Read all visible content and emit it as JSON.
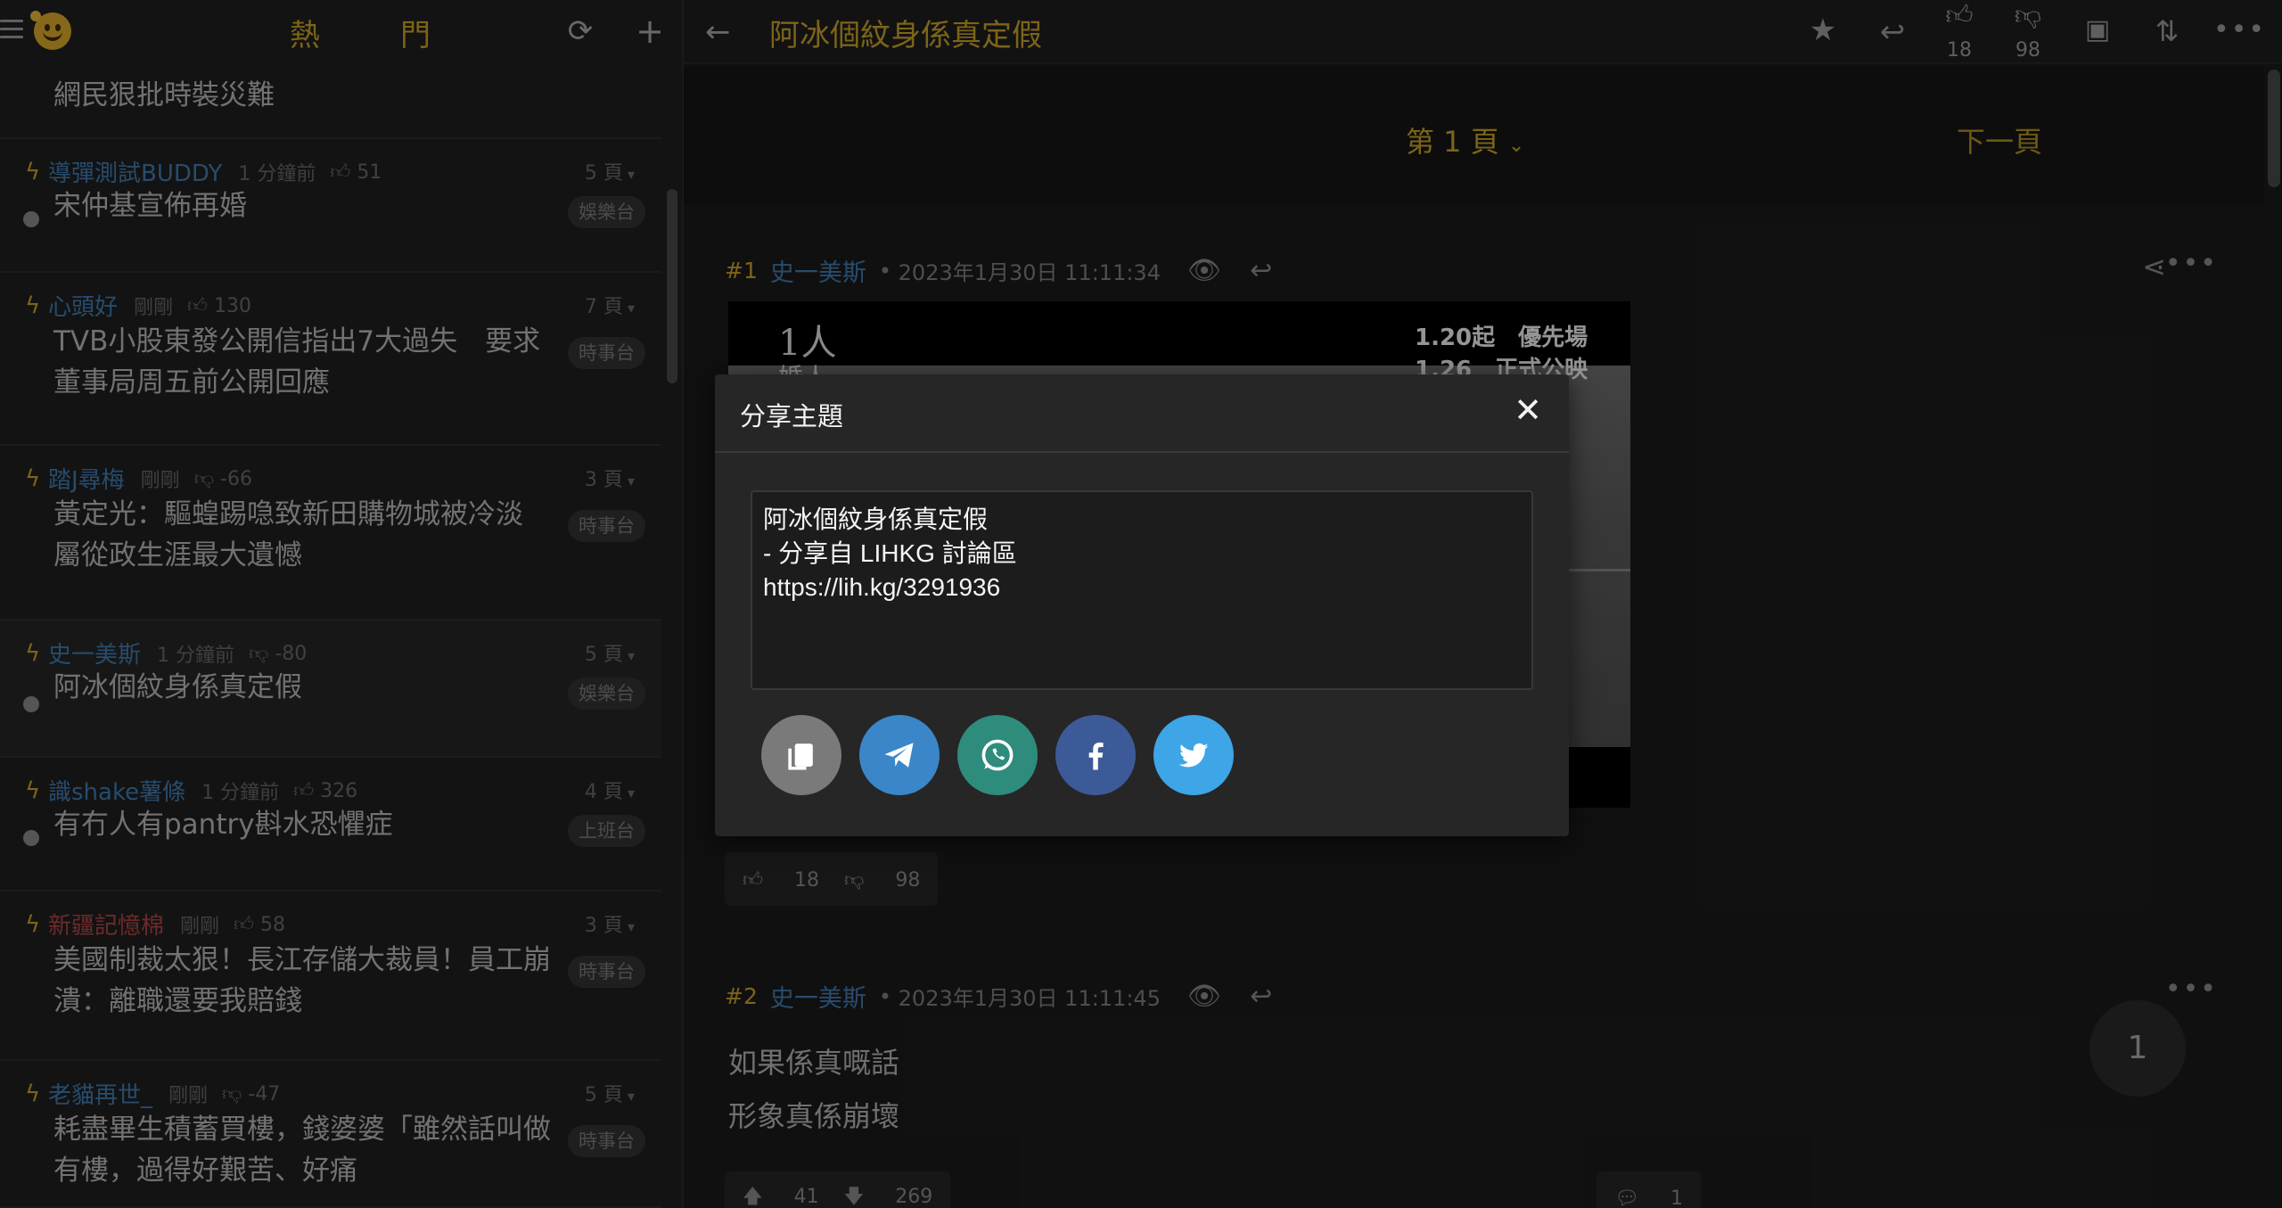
{
  "left_panel": {
    "title": "熱　門",
    "partial_thread_title": "網民狠批時裝災難",
    "threads": [
      {
        "user": "導彈測試BUDDY",
        "time": "1 分鐘前",
        "score": "51",
        "pages": "5 頁",
        "title": "宋仲基宣佈再婚",
        "tag": "娛樂台",
        "score_type": "up",
        "user_color": "blue",
        "active": false
      },
      {
        "user": "心頭好",
        "time": "剛剛",
        "score": "130",
        "pages": "7 頁",
        "title": "TVB小股東發公開信指出7大過失　要求董事局周五前公開回應",
        "tag": "時事台",
        "score_type": "up",
        "user_color": "blue",
        "active": false
      },
      {
        "user": "踏J尋梅",
        "time": "剛剛",
        "score": "-66",
        "pages": "3 頁",
        "title": "黃定光：驅蝗踢喼致新田購物城被冷淡 屬從政生涯最大遺憾",
        "tag": "時事台",
        "score_type": "down",
        "user_color": "blue",
        "active": false
      },
      {
        "user": "史一美斯",
        "time": "1 分鐘前",
        "score": "-80",
        "pages": "5 頁",
        "title": "阿冰個紋身係真定假",
        "tag": "娛樂台",
        "score_type": "down",
        "user_color": "blue",
        "active": true
      },
      {
        "user": "識shake薯條",
        "time": "1 分鐘前",
        "score": "326",
        "pages": "4 頁",
        "title": "有冇人有pantry斟水恐懼症",
        "tag": "上班台",
        "score_type": "up",
        "user_color": "blue",
        "active": false
      },
      {
        "user": "新疆記憶棉",
        "time": "剛剛",
        "score": "58",
        "pages": "3 頁",
        "title": "美國制裁太狠！長江存儲大裁員！員工崩潰：離職還要我賠錢",
        "tag": "時事台",
        "score_type": "up",
        "user_color": "red",
        "active": false
      },
      {
        "user": "老貓再世_",
        "time": "剛剛",
        "score": "-47",
        "pages": "5 頁",
        "title": "耗盡畢生積蓄買樓，錢婆婆「雖然話叫做有樓，過得好艱苦、好痛",
        "tag": "時事台",
        "score_type": "down",
        "user_color": "blue",
        "active": false
      }
    ]
  },
  "topbar": {
    "title": "阿冰個紋身係真定假",
    "like_count": "18",
    "dislike_count": "98"
  },
  "pagebar": {
    "page_label": "第 1 頁",
    "next_label": "下一頁"
  },
  "posts": [
    {
      "num": "#1",
      "user": "史一美斯",
      "date": "2023年1月30日 11:11:34",
      "likes": "18",
      "dislikes": "98",
      "image_text_1": "1.20起　優先場",
      "image_text_2": "1.26　正式公映",
      "image_logo_1": "1人",
      "image_logo_2": "婚人"
    },
    {
      "num": "#2",
      "user": "史一美斯",
      "date": "2023年1月30日 11:11:45",
      "body_line_1": "如果係真嘅話",
      "body_line_2": "形象真係崩壞",
      "likes": "41",
      "dislikes": "269",
      "comments": "1",
      "page_badge": "1"
    }
  ],
  "modal": {
    "title": "分享主題",
    "share_text": "阿冰個紋身係真定假\n- 分享自 LIHKG 討論區\nhttps://lih.kg/3291936",
    "buttons": [
      {
        "name": "copy",
        "color": "#7a7a7a"
      },
      {
        "name": "telegram",
        "color": "#3a86c8"
      },
      {
        "name": "whatsapp",
        "color": "#2e8c7d"
      },
      {
        "name": "facebook",
        "color": "#3d5a98"
      },
      {
        "name": "twitter",
        "color": "#3ea5e6"
      }
    ]
  },
  "colors": {
    "accent": "#c9a227",
    "link": "#3f7bb0",
    "danger_user": "#b04545"
  }
}
